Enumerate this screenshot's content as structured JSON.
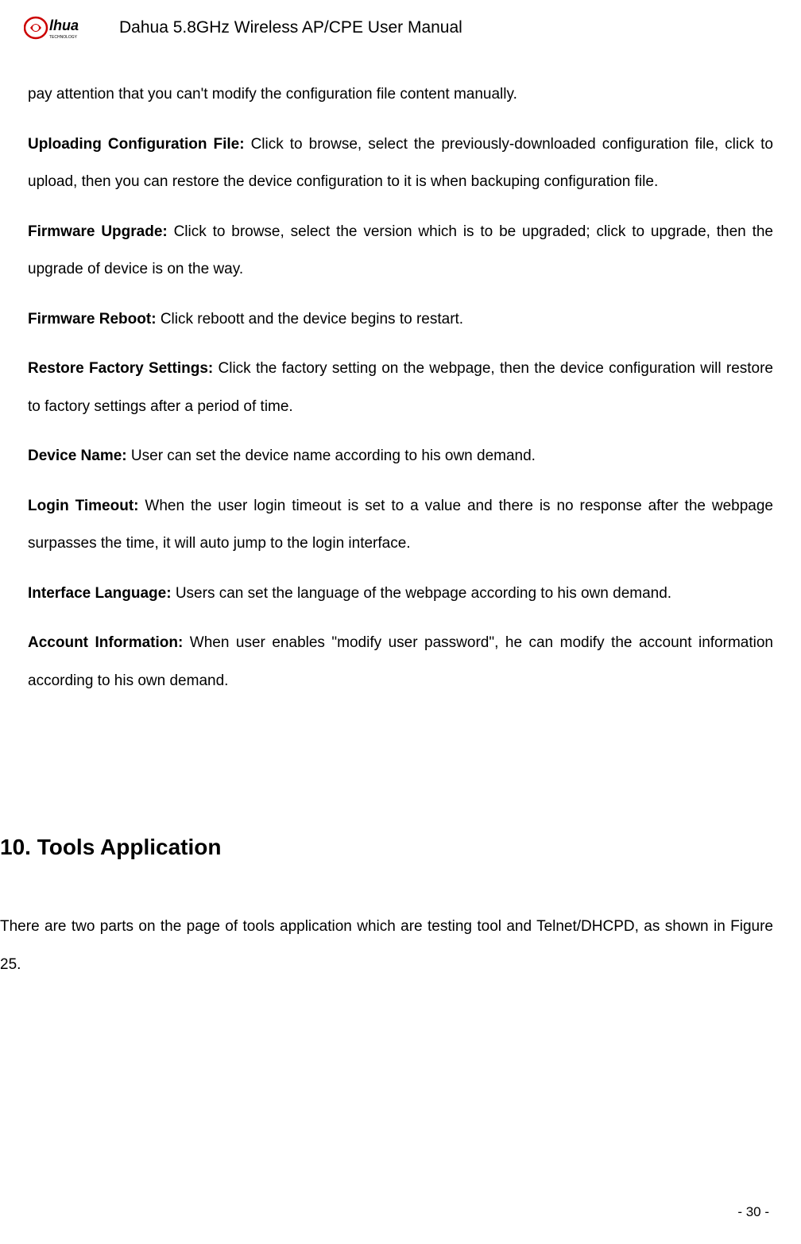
{
  "header": {
    "title": "Dahua 5.8GHz Wireless AP/CPE User Manual",
    "logo_name": "alhua",
    "logo_sub": "TECHNOLOGY"
  },
  "paragraphs": {
    "p1": "pay attention that you can't modify the configuration file content manually.",
    "p2_bold": "Uploading Configuration File: ",
    "p2_text": "Click to browse, select the previously-downloaded configuration file, click to upload, then you can restore the device configuration to it is when backuping configuration file.",
    "p3_bold": "Firmware Upgrade: ",
    "p3_text": "Click to browse, select the version which is to be upgraded; click to upgrade, then the upgrade of device is on the way.",
    "p4_bold": "Firmware Reboot: ",
    "p4_text": "Click reboott and the device begins to restart.",
    "p5_bold": "Restore Factory Settings: ",
    "p5_text": "Click the factory setting on the webpage, then the device configuration will restore to factory settings after a period of time.",
    "p6_bold": "Device Name: ",
    "p6_text": "User can set the device name according to his own demand.",
    "p7_bold": "Login Timeout: ",
    "p7_text": "When the user login timeout is set to a value and there is no response after the webpage surpasses the time, it will auto jump to the login interface.",
    "p8_bold": "Interface Language: ",
    "p8_text": "Users can set the language of the webpage according to his own demand.",
    "p9_bold": "Account Information: ",
    "p9_text": "When user enables \"modify user password\", he can modify the account information according to his own demand."
  },
  "section": {
    "heading": "10. Tools Application",
    "intro": "There are two parts on the page of tools application which are testing tool and Telnet/DHCPD, as shown in Figure 25."
  },
  "footer": {
    "page": "- 30 -"
  }
}
